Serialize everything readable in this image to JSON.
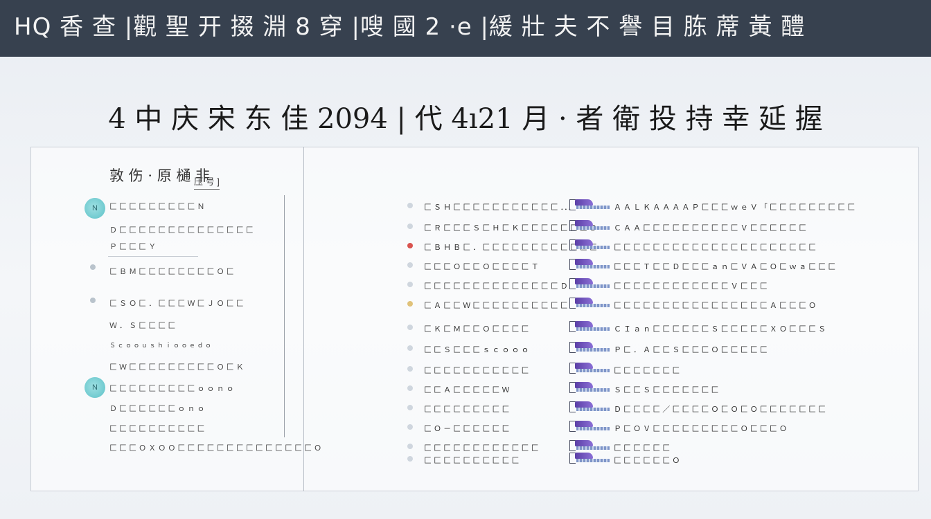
{
  "banner": {
    "title": "HQ 香 查 |觀 聖 开 掇 淵 8 穿 |嗖 國 2 ·e |緩 壯 夫 不 譽 目 胨 蓆 黃 醴"
  },
  "page": {
    "title": "4 中 庆 宋 东 佳 2094 | 代 4ı21 月 · 者 衛 投 持 幸 延 握"
  },
  "left": {
    "header": "敦 伤 · 原 樋 非",
    "header_sub": "压 号 ]",
    "badge_top": "N",
    "badge_bottom": "N",
    "items": [
      "匚 匚 匚 匚 匚 匚 匚 匚 匚 Ｎ",
      "Ｄ 匚 匚 匚 匚 匚 匚 匚 匚 匚 匚 匚 匚 匚 匚",
      "Ｐ 匚 匚 匚 Ｙ",
      "匚 Ｂ Ｍ 匚 匚 匚 匚 匚 匚 匚 匚 Ｏ 匚",
      "匚 Ｓ Ｏ 匚 ． 匚 匚 匚 Ｗ 匚 Ｊ Ｏ 匚 匚",
      "Ｗ ． Ｓ 匚 匚 匚 匚",
      "Ｓ ｃ ｏ ｏ ｕ ｓ ｈ ｉ ｏ ｏ ｅ ｄ ｏ",
      "匚 Ｗ 匚 匚 匚 匚 匚 匚 匚 匚 匚 Ｏ 匚 Ｋ",
      "匚 匚 匚 匚 匚 匚 匚 匚 匚 ｏ ｏ ｎ ｏ",
      "Ｄ 匚 匚 匚 匚 匚 匚 ｏ ｎ ｏ",
      "匚 匚 匚 匚 匚 匚 匚 匚 匚 匚",
      "匚 匚 匚 Ｏ Ｘ Ｏ Ｏ 匚 匚 匚 匚 匚 匚 匚 匚 匚 匚 匚 匚 匚 匚 Ｏ"
    ]
  },
  "rows": [
    {
      "label": "匚 Ｓ Ｈ 匚 匚 匚 匚 匚 匚 匚 匚 匚 匚 匚 ．．．",
      "note": "Ａ Ａ Ｌ Ｋ Ａ Ａ Ａ Ａ Ｐ 匚 匚 匚 ｗ ｅ Ｖ 「 匚 匚 匚 匚 匚 匚 匚 匚 匚",
      "mark": "#cfd6de"
    },
    {
      "label": "匚 Ｒ 匚 匚 匚 Ｓ 匚 Ｈ 匚 Ｋ 匚 匚 匚 匚 匚 匚 匚 Ｄ",
      "note": "Ｃ Ａ Ａ 匚 匚 匚 匚 匚 匚 匚 匚 匚 匚 Ｖ 匚 匚 匚 匚 匚 匚",
      "mark": "#cfd6de"
    },
    {
      "label": "匚 Ｂ Ｈ Ｂ 匚 ． 匚 匚 匚 匚 匚 匚 匚 匚 匚 匚 匚 匚",
      "note": "匚 匚 匚 匚 匚 匚 匚 匚 匚 匚 匚 匚 匚 匚 匚 匚 匚 匚 匚 匚 匚",
      "mark": "#d9534f"
    },
    {
      "label": "匚 匚 匚 Ｏ 匚 匚 Ｏ 匚 匚 匚 匚 Ｔ",
      "note": "匚 匚 匚 Ｔ 匚 匚 Ｄ 匚 匚 匚 ａ ｎ 匚 Ｖ Ａ 匚 Ｏ 匚 ｗ ａ 匚 匚 匚",
      "mark": "#cfd6de"
    },
    {
      "label": "匚 匚 匚 匚 匚 匚 匚 匚 匚 匚 匚 匚 匚 匚 Ｄ",
      "note": "匚 匚 匚 匚 匚 匚 匚 匚 匚 匚 匚 匚 Ｖ 匚 匚 匚",
      "mark": "#cfd6de"
    },
    {
      "label": "匚 Ａ 匚 匚 Ｗ 匚 匚 匚 匚 匚 匚 匚 匚 匚 匚",
      "note": "匚 匚 匚 匚 匚 匚 匚 匚 匚 匚 匚 匚 匚 匚 匚 匚 Ａ 匚 匚 匚 Ｏ",
      "mark": "#e0c27a"
    },
    {
      "label": "匚 Ｋ 匚 Ｍ 匚 匚 Ｏ 匚 匚 匚 匚",
      "note": "Ｃ Ｉ ａ ｎ 匚 匚 匚 匚 匚 匚 Ｓ 匚 匚 匚 匚 匚 Ｘ Ｏ 匚 匚 匚 Ｓ",
      "mark": "#cfd6de"
    },
    {
      "label": "匚 匚 Ｓ 匚 匚 匚 ｓ ｃ ｏ ｏ ｏ",
      "note": "Ｐ 匚 ． Ａ 匚 匚 Ｓ 匚 匚 匚 Ｏ 匚 匚 匚 匚 匚",
      "mark": "#cfd6de"
    },
    {
      "label": "匚 匚 匚 匚 匚 匚 匚 匚 匚 匚 匚",
      "note": "匚 匚 匚 匚 匚 匚 匚",
      "mark": "#cfd6de"
    },
    {
      "label": "匚 匚 Ａ 匚 匚 匚 匚 匚 Ｗ",
      "note": "Ｓ 匚 匚 Ｓ 匚 匚 匚 匚 匚 匚 匚",
      "mark": "#cfd6de"
    },
    {
      "label": "匚 匚 匚 匚 匚 匚 匚 匚 匚",
      "note": "Ｄ 匚 匚 匚 匚 ／ 匚 匚 匚 匚 Ｏ 匚 Ｏ 匚 Ｏ 匚 匚 匚 匚 匚 匚 匚",
      "mark": "#cfd6de"
    },
    {
      "label": "匚 Ｏ － 匚 匚 匚 匚 匚 匚",
      "note": "Ｐ 匚 Ｏ Ｖ 匚 匚 匚 匚 匚 匚 匚 匚 匚 Ｏ 匚 匚 匚 Ｏ",
      "mark": "#cfd6de"
    },
    {
      "label": "匚 匚 匚 匚 匚 匚 匚 匚 匚 匚 匚 匚",
      "note": "匚 匚 匚 匚 匚 匚",
      "mark": "#cfd6de"
    },
    {
      "label": "匚 匚 匚 匚 匚 匚 匚 匚 匚 匚",
      "note": "匚 匚 匚 匚 匚 匚 Ｏ",
      "mark": "#cfd6de"
    }
  ]
}
